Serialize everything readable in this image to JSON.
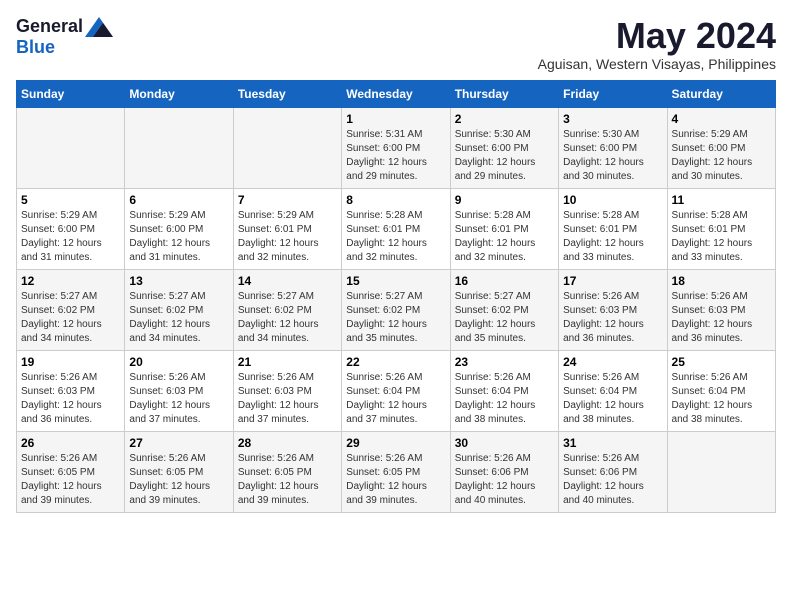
{
  "logo": {
    "general": "General",
    "blue": "Blue"
  },
  "title": {
    "month": "May 2024",
    "location": "Aguisan, Western Visayas, Philippines"
  },
  "weekdays": [
    "Sunday",
    "Monday",
    "Tuesday",
    "Wednesday",
    "Thursday",
    "Friday",
    "Saturday"
  ],
  "weeks": [
    [
      {
        "day": "",
        "sunrise": "",
        "sunset": "",
        "daylight": ""
      },
      {
        "day": "",
        "sunrise": "",
        "sunset": "",
        "daylight": ""
      },
      {
        "day": "",
        "sunrise": "",
        "sunset": "",
        "daylight": ""
      },
      {
        "day": "1",
        "sunrise": "Sunrise: 5:31 AM",
        "sunset": "Sunset: 6:00 PM",
        "daylight": "Daylight: 12 hours and 29 minutes."
      },
      {
        "day": "2",
        "sunrise": "Sunrise: 5:30 AM",
        "sunset": "Sunset: 6:00 PM",
        "daylight": "Daylight: 12 hours and 29 minutes."
      },
      {
        "day": "3",
        "sunrise": "Sunrise: 5:30 AM",
        "sunset": "Sunset: 6:00 PM",
        "daylight": "Daylight: 12 hours and 30 minutes."
      },
      {
        "day": "4",
        "sunrise": "Sunrise: 5:29 AM",
        "sunset": "Sunset: 6:00 PM",
        "daylight": "Daylight: 12 hours and 30 minutes."
      }
    ],
    [
      {
        "day": "5",
        "sunrise": "Sunrise: 5:29 AM",
        "sunset": "Sunset: 6:00 PM",
        "daylight": "Daylight: 12 hours and 31 minutes."
      },
      {
        "day": "6",
        "sunrise": "Sunrise: 5:29 AM",
        "sunset": "Sunset: 6:00 PM",
        "daylight": "Daylight: 12 hours and 31 minutes."
      },
      {
        "day": "7",
        "sunrise": "Sunrise: 5:29 AM",
        "sunset": "Sunset: 6:01 PM",
        "daylight": "Daylight: 12 hours and 32 minutes."
      },
      {
        "day": "8",
        "sunrise": "Sunrise: 5:28 AM",
        "sunset": "Sunset: 6:01 PM",
        "daylight": "Daylight: 12 hours and 32 minutes."
      },
      {
        "day": "9",
        "sunrise": "Sunrise: 5:28 AM",
        "sunset": "Sunset: 6:01 PM",
        "daylight": "Daylight: 12 hours and 32 minutes."
      },
      {
        "day": "10",
        "sunrise": "Sunrise: 5:28 AM",
        "sunset": "Sunset: 6:01 PM",
        "daylight": "Daylight: 12 hours and 33 minutes."
      },
      {
        "day": "11",
        "sunrise": "Sunrise: 5:28 AM",
        "sunset": "Sunset: 6:01 PM",
        "daylight": "Daylight: 12 hours and 33 minutes."
      }
    ],
    [
      {
        "day": "12",
        "sunrise": "Sunrise: 5:27 AM",
        "sunset": "Sunset: 6:02 PM",
        "daylight": "Daylight: 12 hours and 34 minutes."
      },
      {
        "day": "13",
        "sunrise": "Sunrise: 5:27 AM",
        "sunset": "Sunset: 6:02 PM",
        "daylight": "Daylight: 12 hours and 34 minutes."
      },
      {
        "day": "14",
        "sunrise": "Sunrise: 5:27 AM",
        "sunset": "Sunset: 6:02 PM",
        "daylight": "Daylight: 12 hours and 34 minutes."
      },
      {
        "day": "15",
        "sunrise": "Sunrise: 5:27 AM",
        "sunset": "Sunset: 6:02 PM",
        "daylight": "Daylight: 12 hours and 35 minutes."
      },
      {
        "day": "16",
        "sunrise": "Sunrise: 5:27 AM",
        "sunset": "Sunset: 6:02 PM",
        "daylight": "Daylight: 12 hours and 35 minutes."
      },
      {
        "day": "17",
        "sunrise": "Sunrise: 5:26 AM",
        "sunset": "Sunset: 6:03 PM",
        "daylight": "Daylight: 12 hours and 36 minutes."
      },
      {
        "day": "18",
        "sunrise": "Sunrise: 5:26 AM",
        "sunset": "Sunset: 6:03 PM",
        "daylight": "Daylight: 12 hours and 36 minutes."
      }
    ],
    [
      {
        "day": "19",
        "sunrise": "Sunrise: 5:26 AM",
        "sunset": "Sunset: 6:03 PM",
        "daylight": "Daylight: 12 hours and 36 minutes."
      },
      {
        "day": "20",
        "sunrise": "Sunrise: 5:26 AM",
        "sunset": "Sunset: 6:03 PM",
        "daylight": "Daylight: 12 hours and 37 minutes."
      },
      {
        "day": "21",
        "sunrise": "Sunrise: 5:26 AM",
        "sunset": "Sunset: 6:03 PM",
        "daylight": "Daylight: 12 hours and 37 minutes."
      },
      {
        "day": "22",
        "sunrise": "Sunrise: 5:26 AM",
        "sunset": "Sunset: 6:04 PM",
        "daylight": "Daylight: 12 hours and 37 minutes."
      },
      {
        "day": "23",
        "sunrise": "Sunrise: 5:26 AM",
        "sunset": "Sunset: 6:04 PM",
        "daylight": "Daylight: 12 hours and 38 minutes."
      },
      {
        "day": "24",
        "sunrise": "Sunrise: 5:26 AM",
        "sunset": "Sunset: 6:04 PM",
        "daylight": "Daylight: 12 hours and 38 minutes."
      },
      {
        "day": "25",
        "sunrise": "Sunrise: 5:26 AM",
        "sunset": "Sunset: 6:04 PM",
        "daylight": "Daylight: 12 hours and 38 minutes."
      }
    ],
    [
      {
        "day": "26",
        "sunrise": "Sunrise: 5:26 AM",
        "sunset": "Sunset: 6:05 PM",
        "daylight": "Daylight: 12 hours and 39 minutes."
      },
      {
        "day": "27",
        "sunrise": "Sunrise: 5:26 AM",
        "sunset": "Sunset: 6:05 PM",
        "daylight": "Daylight: 12 hours and 39 minutes."
      },
      {
        "day": "28",
        "sunrise": "Sunrise: 5:26 AM",
        "sunset": "Sunset: 6:05 PM",
        "daylight": "Daylight: 12 hours and 39 minutes."
      },
      {
        "day": "29",
        "sunrise": "Sunrise: 5:26 AM",
        "sunset": "Sunset: 6:05 PM",
        "daylight": "Daylight: 12 hours and 39 minutes."
      },
      {
        "day": "30",
        "sunrise": "Sunrise: 5:26 AM",
        "sunset": "Sunset: 6:06 PM",
        "daylight": "Daylight: 12 hours and 40 minutes."
      },
      {
        "day": "31",
        "sunrise": "Sunrise: 5:26 AM",
        "sunset": "Sunset: 6:06 PM",
        "daylight": "Daylight: 12 hours and 40 minutes."
      },
      {
        "day": "",
        "sunrise": "",
        "sunset": "",
        "daylight": ""
      }
    ]
  ]
}
